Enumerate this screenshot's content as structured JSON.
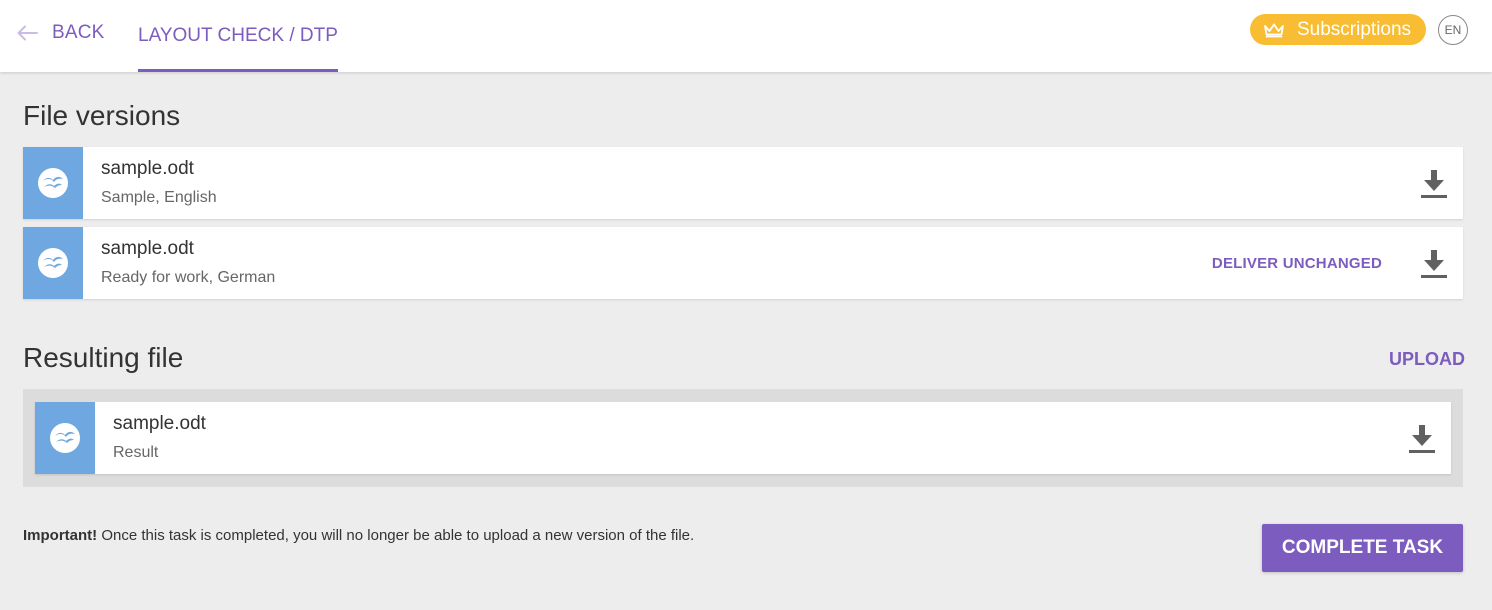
{
  "header": {
    "back_label": "BACK",
    "tab_label": "LAYOUT CHECK / DTP",
    "subscriptions_label": "Subscriptions",
    "language": "EN"
  },
  "file_versions": {
    "title": "File versions",
    "files": [
      {
        "name": "sample.odt",
        "meta": "Sample, English"
      },
      {
        "name": "sample.odt",
        "meta": "Ready for work, German",
        "action": "DELIVER UNCHANGED"
      }
    ]
  },
  "resulting": {
    "title": "Resulting file",
    "upload_label": "UPLOAD",
    "file": {
      "name": "sample.odt",
      "meta": "Result"
    }
  },
  "footer": {
    "important_label": "Important!",
    "note": " Once this task is completed, you will no longer be able to upload a new version of the file.",
    "complete_label": "COMPLETE TASK"
  },
  "colors": {
    "accent": "#7c5cbf",
    "subscriptions": "#f9bd33",
    "file_icon": "#6fa8e0",
    "background": "#ededed"
  },
  "icons": {
    "back": "arrow-left-icon",
    "subscriptions": "crown-icon",
    "file": "openoffice-document-icon",
    "download": "download-icon"
  }
}
